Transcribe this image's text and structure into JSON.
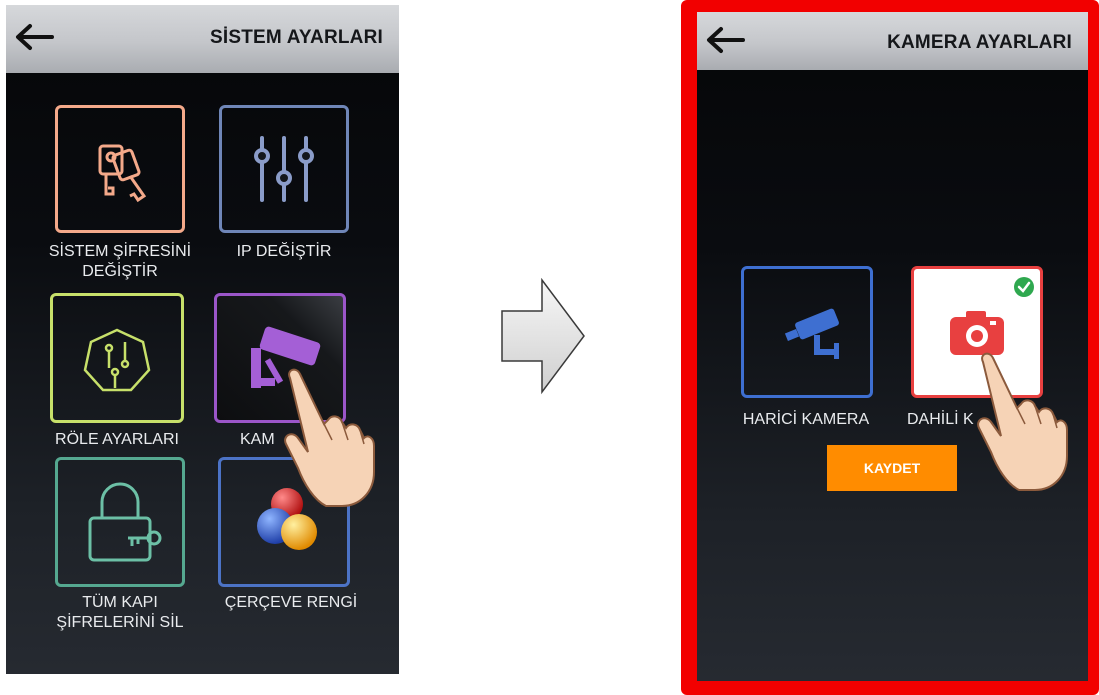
{
  "left_screen": {
    "title": "SİSTEM AYARLARI",
    "tiles": [
      {
        "line1": "SİSTEM ŞİFRESİNİ",
        "line2": "DEĞİŞTİR",
        "icon": "keys-icon",
        "color": "#f4a98a"
      },
      {
        "line1": "IP DEĞİŞTİR",
        "icon": "sliders-icon",
        "color": "#6f86b8"
      },
      {
        "line1": "RÖLE AYARLARI",
        "icon": "circuit-icon",
        "color": "#c7e06a"
      },
      {
        "line1": "KAM",
        "icon": "security-camera-icon",
        "color": "#9b56c9"
      },
      {
        "line1": "TÜM KAPI",
        "line2": "ŞİFRELERİNİ SİL",
        "icon": "lock-key-icon",
        "color": "#55a890"
      },
      {
        "line1": "ÇERÇEVE RENGİ",
        "icon": "color-balls-icon",
        "color": "#4c73c6"
      }
    ]
  },
  "right_screen": {
    "title": "KAMERA AYARLARI",
    "options": [
      {
        "label": "HARİCİ KAMERA",
        "icon": "security-camera-icon",
        "color": "#3e6fd1"
      },
      {
        "label": "DAHİLİ K",
        "icon": "camera-icon",
        "color": "#e84040",
        "selected": true
      }
    ],
    "save_button": "KAYDET"
  },
  "colors": {
    "highlight_frame": "#f20000",
    "save_button": "#ff8c00",
    "check_badge": "#2fa84f"
  }
}
